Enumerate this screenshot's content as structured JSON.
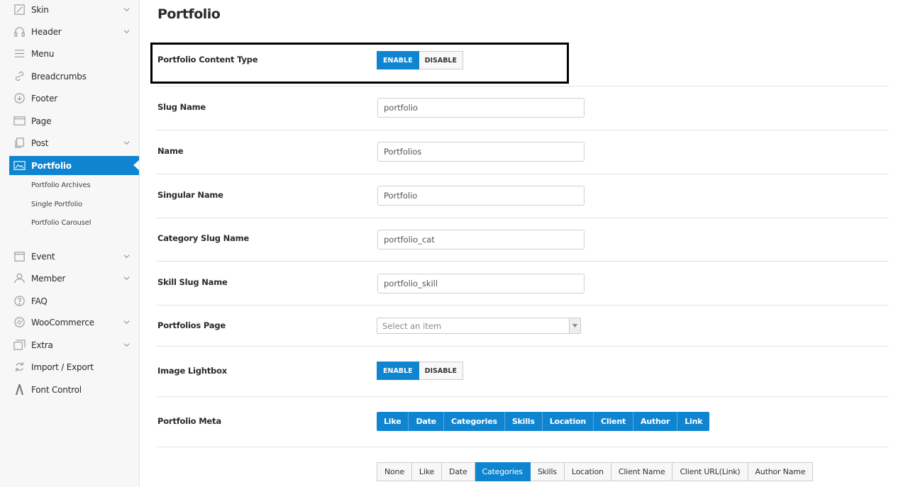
{
  "sidebar": {
    "items": [
      {
        "label": "Skin",
        "icon": "brush-icon",
        "chevron": true
      },
      {
        "label": "Header",
        "icon": "headphones-icon",
        "chevron": true
      },
      {
        "label": "Menu",
        "icon": "menu-icon",
        "chevron": false
      },
      {
        "label": "Breadcrumbs",
        "icon": "link-icon",
        "chevron": false
      },
      {
        "label": "Footer",
        "icon": "arrow-down-circle-icon",
        "chevron": false
      },
      {
        "label": "Page",
        "icon": "browser-window-icon",
        "chevron": false
      },
      {
        "label": "Post",
        "icon": "copy-icon",
        "chevron": true
      },
      {
        "label": "Portfolio",
        "icon": "image-icon",
        "chevron": false,
        "active": true
      },
      {
        "label": "Event",
        "icon": "calendar-icon",
        "chevron": true
      },
      {
        "label": "Member",
        "icon": "user-icon",
        "chevron": true
      },
      {
        "label": "FAQ",
        "icon": "question-circle-icon",
        "chevron": false
      },
      {
        "label": "WooCommerce",
        "icon": "woocommerce-icon",
        "chevron": true
      },
      {
        "label": "Extra",
        "icon": "layers-icon",
        "chevron": true
      },
      {
        "label": "Import / Export",
        "icon": "refresh-icon",
        "chevron": false
      },
      {
        "label": "Font Control",
        "icon": "font-icon",
        "chevron": false
      }
    ],
    "subitems": [
      "Portfolio Archives",
      "Single Portfolio",
      "Portfolio Carousel"
    ]
  },
  "main": {
    "title": "Portfolio",
    "content_type": {
      "label": "Portfolio Content Type",
      "enable": "ENABLE",
      "disable": "DISABLE",
      "selected": "ENABLE"
    },
    "slug_name": {
      "label": "Slug Name",
      "value": "portfolio"
    },
    "name": {
      "label": "Name",
      "value": "Portfolios"
    },
    "singular_name": {
      "label": "Singular Name",
      "value": "Portfolio"
    },
    "category_slug": {
      "label": "Category Slug Name",
      "value": "portfolio_cat"
    },
    "skill_slug": {
      "label": "Skill Slug Name",
      "value": "portfolio_skill"
    },
    "portfolios_page": {
      "label": "Portfolios Page",
      "placeholder": "Select an item"
    },
    "image_lightbox": {
      "label": "Image Lightbox",
      "enable": "ENABLE",
      "disable": "DISABLE",
      "selected": "ENABLE"
    },
    "portfolio_meta": {
      "label": "Portfolio Meta",
      "buttons": [
        "Like",
        "Date",
        "Categories",
        "Skills",
        "Location",
        "Client",
        "Author",
        "Link"
      ]
    },
    "meta_options": {
      "buttons": [
        "None",
        "Like",
        "Date",
        "Categories",
        "Skills",
        "Location",
        "Client Name",
        "Client URL(Link)",
        "Author Name"
      ],
      "selected": "Categories"
    }
  },
  "colors": {
    "accent": "#0f85d1",
    "sidebar_bg": "#f7f7f7",
    "highlight_border": "#000000"
  }
}
